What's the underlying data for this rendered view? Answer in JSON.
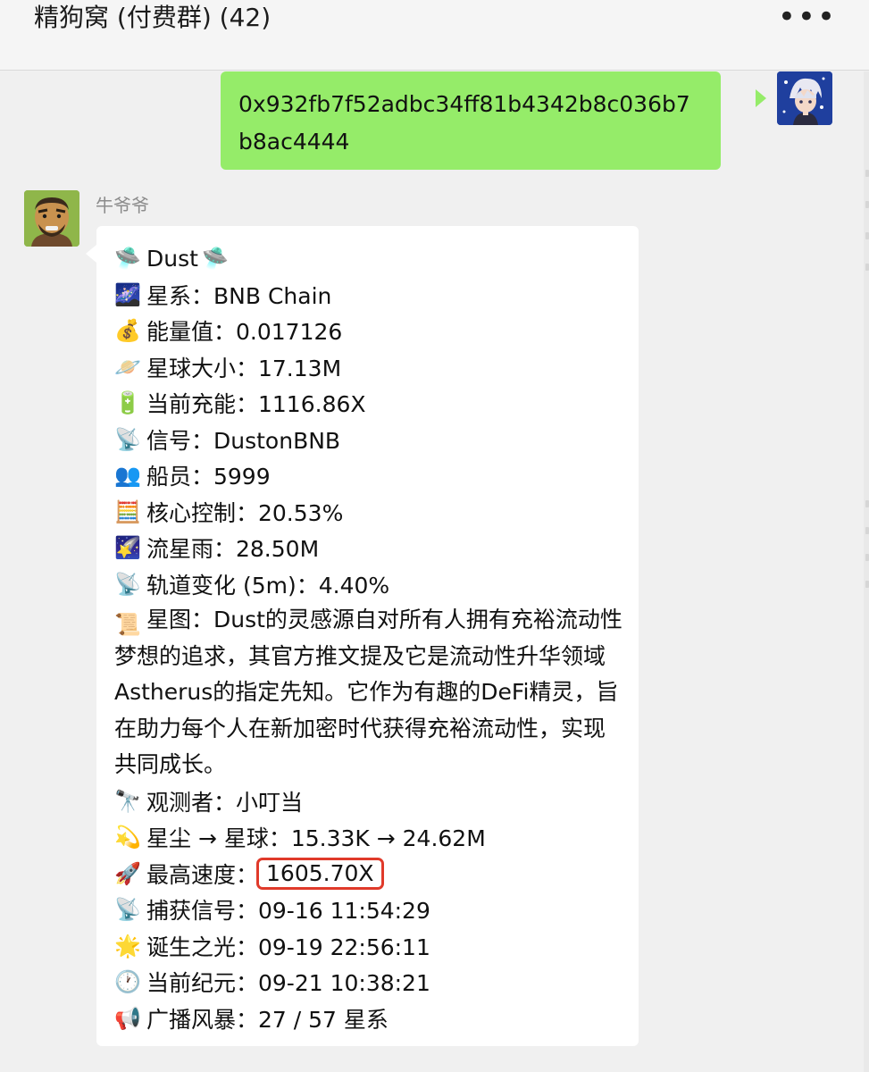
{
  "window": {
    "title": "精狗窝 (付费群)  (42)",
    "more_label": "•••"
  },
  "outgoing": {
    "text": "0x932fb7f52adbc34ff81b4342b8c036b7b8ac4444"
  },
  "incoming": {
    "sender": "牛爷爷",
    "title": "Dust",
    "lines": [
      {
        "emoji": "🌌",
        "text": "星系：BNB Chain"
      },
      {
        "emoji": "💰",
        "text": "能量值：0.017126"
      },
      {
        "emoji": "🪐",
        "text": "星球大小：17.13M"
      },
      {
        "emoji": "🔋",
        "text": "当前充能：1116.86X"
      },
      {
        "emoji": "📡",
        "text": "信号：DustonBNB"
      },
      {
        "emoji": "👥",
        "text": "船员：5999"
      },
      {
        "emoji": "🧮",
        "text": "核心控制：20.53%"
      },
      {
        "emoji": "🌠",
        "text": "流星雨：28.50M"
      },
      {
        "emoji": "📡",
        "text": "轨道变化 (5m)：4.40%"
      }
    ],
    "star_map": {
      "emoji": "📜",
      "text": "星图：Dust的灵感源自对所有人拥有充裕流动性梦想的追求，其官方推文提及它是流动性升华领域Astherus的指定先知。它作为有趣的DeFi精灵，旨在助力每个人在新加密时代获得充裕流动性，实现共同成长。"
    },
    "lines2": [
      {
        "emoji": "🔭",
        "text": "观测者：小叮当"
      },
      {
        "emoji": "💫",
        "text": "星尘 → 星球：15.33K → 24.62M"
      }
    ],
    "max_speed": {
      "emoji": "🚀",
      "label": "最高速度：",
      "value": "1605.70X"
    },
    "lines3": [
      {
        "emoji": "📡",
        "text": "捕获信号：09-16 11:54:29"
      },
      {
        "emoji": "🌟",
        "text": "诞生之光：09-19 22:56:11"
      },
      {
        "emoji": "🕐",
        "text": "当前纪元：09-21 10:38:21"
      },
      {
        "emoji": "📢",
        "text": "广播风暴：27 / 57 星系"
      }
    ]
  },
  "colors": {
    "outgoing_bubble": "#95ec69",
    "incoming_bubble": "#ffffff",
    "highlight_box": "#e03a2a",
    "chat_background": "#f0f0f0"
  }
}
